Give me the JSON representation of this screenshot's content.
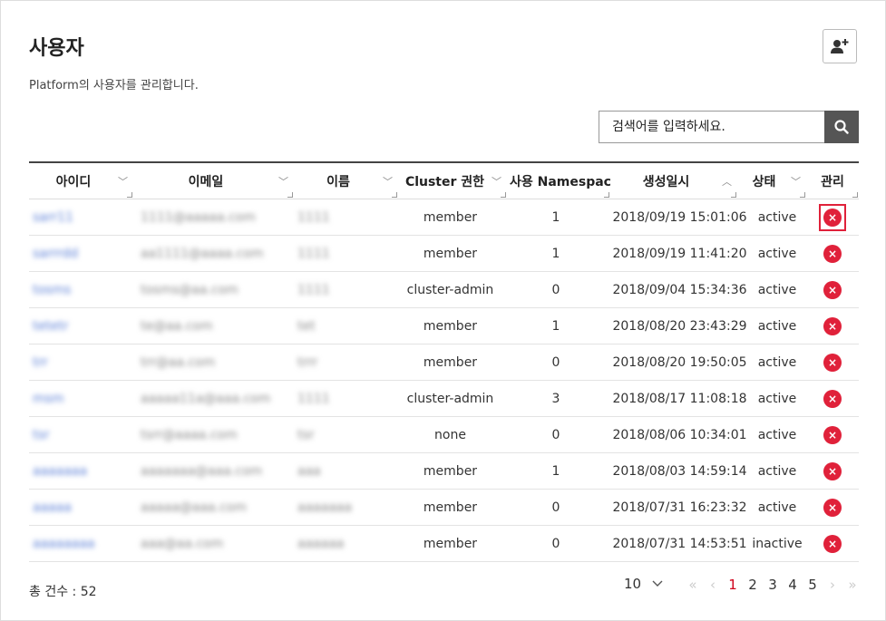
{
  "page": {
    "title": "사용자",
    "description": "Platform의 사용자를 관리합니다."
  },
  "search": {
    "placeholder": "검색어를 입력하세요."
  },
  "columns": [
    "아이디",
    "이메일",
    "이름",
    "Cluster 권한",
    "사용 Namespace",
    "생성일시",
    "상태",
    "관리"
  ],
  "rows": [
    {
      "id": "sarr11",
      "email": "1111@aaaaa.com",
      "name": "1111",
      "role": "member",
      "namespaces": "1",
      "created": "2018/09/19 15:01:06",
      "status": "active"
    },
    {
      "id": "sarrrdd",
      "email": "aa1111@aaaa.com",
      "name": "1111",
      "role": "member",
      "namespaces": "1",
      "created": "2018/09/19 11:41:20",
      "status": "active"
    },
    {
      "id": "tosms",
      "email": "tosms@aa.com",
      "name": "1111",
      "role": "cluster-admin",
      "namespaces": "0",
      "created": "2018/09/04 15:34:36",
      "status": "active"
    },
    {
      "id": "tetetr",
      "email": "te@aa.com",
      "name": "tet",
      "role": "member",
      "namespaces": "1",
      "created": "2018/08/20 23:43:29",
      "status": "active"
    },
    {
      "id": "trr",
      "email": "trr@aa.com",
      "name": "trrr",
      "role": "member",
      "namespaces": "0",
      "created": "2018/08/20 19:50:05",
      "status": "active"
    },
    {
      "id": "msm",
      "email": "aaaaa11a@aaa.com",
      "name": "1111",
      "role": "cluster-admin",
      "namespaces": "3",
      "created": "2018/08/17 11:08:18",
      "status": "active"
    },
    {
      "id": "tsr",
      "email": "tsrr@aaaa.com",
      "name": "tsr",
      "role": "none",
      "namespaces": "0",
      "created": "2018/08/06 10:34:01",
      "status": "active"
    },
    {
      "id": "aaaaaaa",
      "email": "aaaaaaa@aaa.com",
      "name": "aaa",
      "role": "member",
      "namespaces": "1",
      "created": "2018/08/03 14:59:14",
      "status": "active"
    },
    {
      "id": "aaaaa",
      "email": "aaaaa@aaa.com",
      "name": "aaaaaaa",
      "role": "member",
      "namespaces": "0",
      "created": "2018/07/31 16:23:32",
      "status": "active"
    },
    {
      "id": "aaaaaaaa",
      "email": "aaa@aa.com",
      "name": "aaaaaa",
      "role": "member",
      "namespaces": "0",
      "created": "2018/07/31 14:53:51",
      "status": "inactive"
    }
  ],
  "footer": {
    "total": "총 건수 : 52",
    "page_size": "10",
    "pages": [
      "1",
      "2",
      "3",
      "4",
      "5"
    ],
    "current_page": "1"
  },
  "icons": {
    "add_user": "add-user-icon",
    "search": "search-icon",
    "delete": "delete-icon",
    "sort": "chevron-down-icon"
  },
  "colors": {
    "delete": "#e0213a",
    "active_page": "#d0021b",
    "link": "#5b7fd6"
  }
}
